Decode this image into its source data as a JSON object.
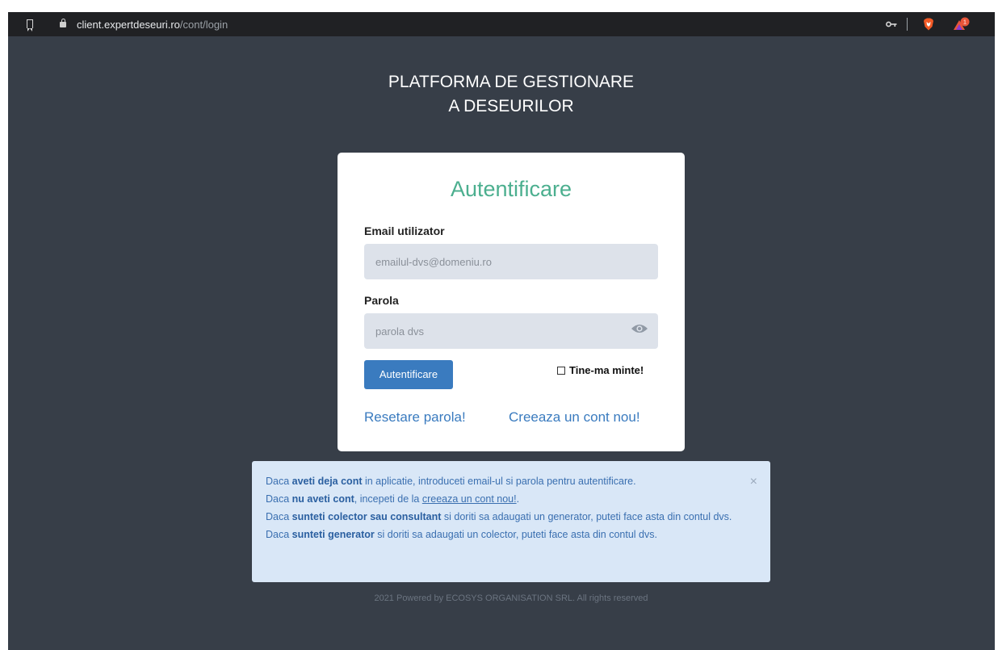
{
  "browser": {
    "url_host": "client.expertdeseuri.ro",
    "url_path": "/cont/login",
    "rewards_badge": "1"
  },
  "page": {
    "title_line1": "PLATFORMA DE GESTIONARE",
    "title_line2": "A DESEURILOR"
  },
  "login": {
    "heading": "Autentificare",
    "email_label": "Email utilizator",
    "email_placeholder": "emailul-dvs@domeniu.ro",
    "password_label": "Parola",
    "password_placeholder": "parola dvs",
    "submit_label": "Autentificare",
    "remember_label": "Tine-ma minte!",
    "reset_link": "Resetare parola!",
    "create_link": "Creeaza un cont nou!"
  },
  "info": {
    "close": "×",
    "l1_a": "Daca ",
    "l1_b": "aveti deja cont",
    "l1_c": " in aplicatie, introduceti email-ul si parola pentru autentificare.",
    "l2_a": "Daca ",
    "l2_b": "nu aveti cont",
    "l2_c": ", incepeti de la ",
    "l2_link": "creeaza un cont nou!",
    "l2_d": ".",
    "l3_a": "Daca ",
    "l3_b": "sunteti colector sau consultant",
    "l3_c": " si doriti sa adaugati un generator, puteti face asta din contul dvs.",
    "l4_a": "Daca ",
    "l4_b": "sunteti generator",
    "l4_c": " si doriti sa adaugati un colector, puteti face asta din contul dvs."
  },
  "footer": {
    "text": "2021 Powered by ECOSYS ORGANISATION SRL. All rights reserved"
  }
}
